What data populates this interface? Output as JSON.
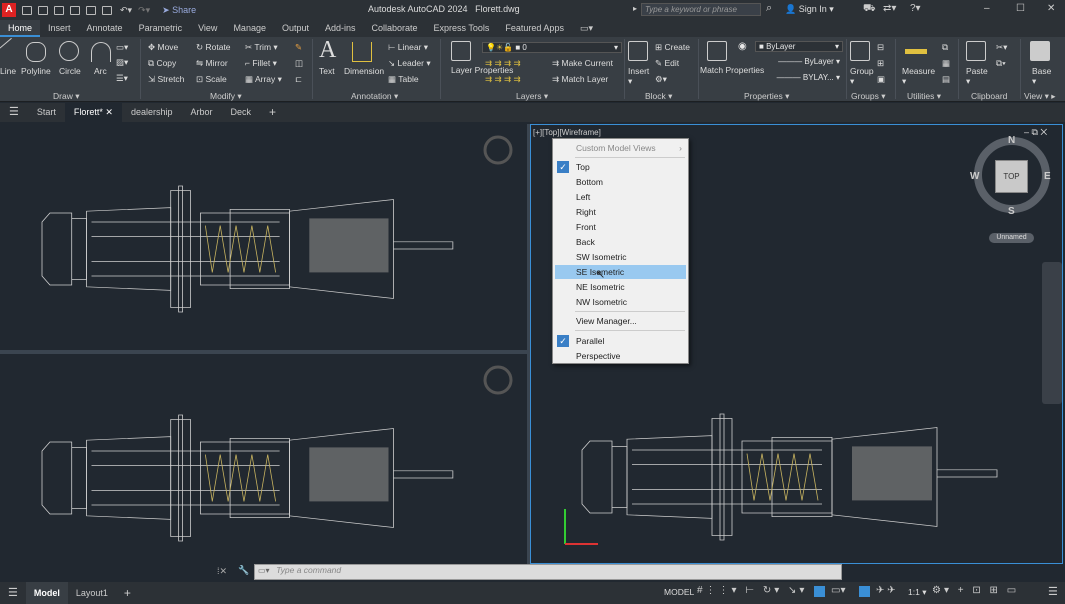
{
  "app": {
    "name": "Autodesk AutoCAD 2024",
    "file": "Florett.dwg"
  },
  "quick_access": {
    "share_label": "Share"
  },
  "search": {
    "placeholder": "Type a keyword or phrase"
  },
  "account": {
    "signin_label": "Sign In"
  },
  "ribbon_tabs": [
    "Home",
    "Insert",
    "Annotate",
    "Parametric",
    "View",
    "Manage",
    "Output",
    "Add-ins",
    "Collaborate",
    "Express Tools",
    "Featured Apps"
  ],
  "ribbon": {
    "draw": {
      "title": "Draw",
      "tools": [
        "Line",
        "Polyline",
        "Circle",
        "Arc"
      ]
    },
    "modify": {
      "title": "Modify",
      "tools": [
        "Move",
        "Rotate",
        "Trim",
        "Copy",
        "Mirror",
        "Fillet",
        "Stretch",
        "Scale",
        "Array"
      ]
    },
    "annotation": {
      "title": "Annotation",
      "tools": [
        "Text",
        "Dimension",
        "Linear",
        "Leader",
        "Table"
      ]
    },
    "layers": {
      "title": "Layers",
      "tools": [
        "Layer Properties",
        "Make Current",
        "Match Layer"
      ],
      "current_layer": "0"
    },
    "block": {
      "title": "Block",
      "tools": [
        "Insert",
        "Create",
        "Edit"
      ]
    },
    "properties": {
      "title": "Properties",
      "tools": [
        "Match Properties"
      ],
      "color": "ByLayer",
      "linetype": "ByLayer",
      "lineweight": "BYLAY..."
    },
    "groups": {
      "title": "Groups",
      "tools": [
        "Group"
      ]
    },
    "utilities": {
      "title": "Utilities",
      "tools": [
        "Measure"
      ]
    },
    "clipboard": {
      "title": "Clipboard",
      "tools": [
        "Paste"
      ]
    },
    "view": {
      "title": "View",
      "tools": [
        "Base"
      ]
    }
  },
  "file_tabs": [
    "Start",
    "Florett*",
    "dealership",
    "Arbor",
    "Deck"
  ],
  "viewport": {
    "label": "[+][Top][Wireframe]",
    "viewcube_face": "TOP",
    "compass": {
      "n": "N",
      "s": "S",
      "e": "E",
      "w": "W"
    },
    "ucs_name": "Unnamed"
  },
  "view_menu": {
    "header": "Custom Model Views",
    "items": [
      "Top",
      "Bottom",
      "Left",
      "Right",
      "Front",
      "Back",
      "SW Isometric",
      "SE Isometric",
      "NE Isometric",
      "NW Isometric"
    ],
    "checked": "Top",
    "highlighted": "SE Isometric",
    "manager": "View Manager...",
    "projection": [
      "Parallel",
      "Perspective"
    ],
    "projection_checked": "Parallel"
  },
  "command_line": {
    "placeholder": "Type a command"
  },
  "status": {
    "layout_tabs": [
      "Model",
      "Layout1"
    ],
    "model_label": "MODEL",
    "scale": "1:1"
  },
  "colors": {
    "accent": "#3a8fd6",
    "highlight": "#99c9f0",
    "background": "#212830"
  }
}
